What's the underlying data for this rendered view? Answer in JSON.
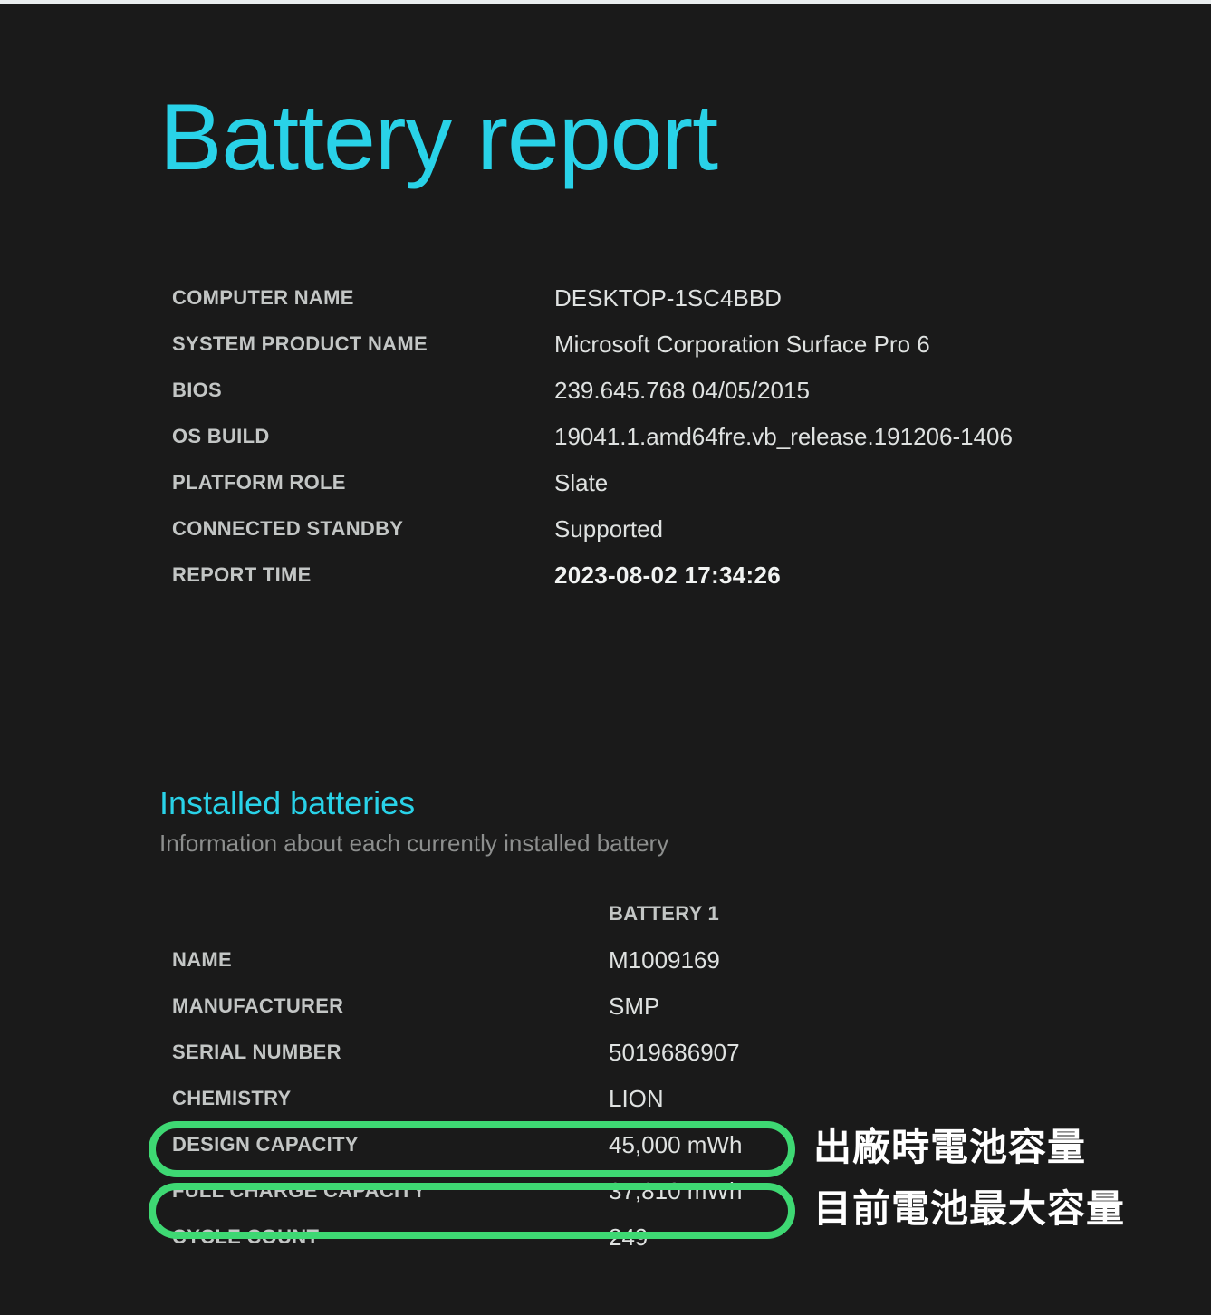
{
  "report": {
    "title": "Battery report",
    "title_color": "#29d2e8",
    "background_color": "#1a1a1a"
  },
  "system_info": {
    "rows": [
      {
        "label": "COMPUTER NAME",
        "value": "DESKTOP-1SC4BBD"
      },
      {
        "label": "SYSTEM PRODUCT NAME",
        "value": "Microsoft Corporation Surface Pro 6"
      },
      {
        "label": "BIOS",
        "value": "239.645.768 04/05/2015"
      },
      {
        "label": "OS BUILD",
        "value": "19041.1.amd64fre.vb_release.191206-1406"
      },
      {
        "label": "PLATFORM ROLE",
        "value": "Slate"
      },
      {
        "label": "CONNECTED STANDBY",
        "value": "Supported"
      },
      {
        "label": "REPORT TIME",
        "value": "2023-08-02  17:34:26"
      }
    ]
  },
  "installed_batteries": {
    "heading": "Installed batteries",
    "subheading": "Information about each currently installed battery",
    "column_header": "BATTERY 1",
    "rows": [
      {
        "label": "NAME",
        "value": "M1009169"
      },
      {
        "label": "MANUFACTURER",
        "value": "SMP"
      },
      {
        "label": "SERIAL NUMBER",
        "value": "5019686907"
      },
      {
        "label": "CHEMISTRY",
        "value": "LION"
      },
      {
        "label": "DESIGN CAPACITY",
        "value": "45,000 mWh"
      },
      {
        "label": "FULL CHARGE CAPACITY",
        "value": "37,810 mWh"
      },
      {
        "label": "CYCLE COUNT",
        "value": "249"
      }
    ]
  },
  "annotations": {
    "highlight_color": "#3ed873",
    "design_capacity_note": "出廠時電池容量",
    "full_charge_capacity_note": "目前電池最大容量"
  }
}
